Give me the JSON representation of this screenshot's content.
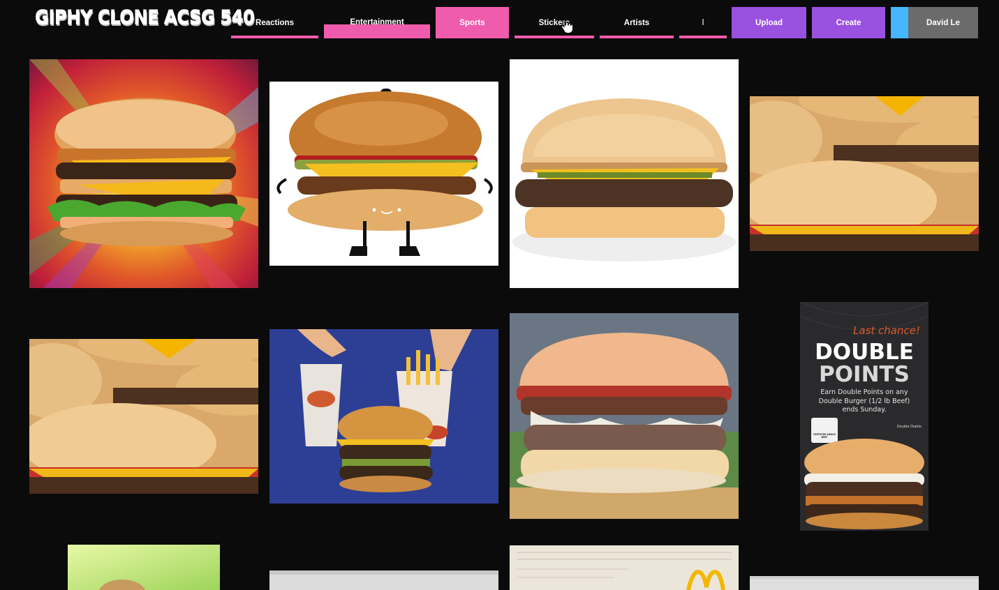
{
  "app": {
    "logo_text": "GIPHY CLONE ACSG 540"
  },
  "nav": {
    "items": [
      {
        "label": "Reactions",
        "accent": "#f05cad"
      },
      {
        "label": "Entertainment",
        "accent": "#f05cad"
      },
      {
        "label": "Sports",
        "accent": "#f05cad"
      },
      {
        "label": "Stickers",
        "accent": "#f05cad"
      },
      {
        "label": "Artists",
        "accent": "#f05cad"
      },
      {
        "label": "⋮",
        "accent": "#f05cad"
      }
    ]
  },
  "actions": {
    "upload_label": "Upload",
    "create_label": "Create",
    "user_name": "David Le",
    "upload_color": "#9b51e0",
    "create_color": "#9b51e0",
    "user_accent": "#46b6ff"
  },
  "gifs": [
    {
      "name": "double-cheeseburger-rainbow-burst-gif"
    },
    {
      "name": "cartoon-burger-with-hat-gif"
    },
    {
      "name": "single-cheeseburger-white-bg-gif"
    },
    {
      "name": "stacked-cheeseburgers-gif"
    },
    {
      "name": "stacked-cheeseburgers-gif-2"
    },
    {
      "name": "burger-king-fries-ad-gif"
    },
    {
      "name": "juicy-burger-close-up-gif"
    },
    {
      "name": "double-points-burger-ad-gif"
    },
    {
      "name": "burger-green-bg-gif"
    },
    {
      "name": "grey-burger-gif"
    },
    {
      "name": "mcdonalds-paper-gif"
    },
    {
      "name": "grey-burger-gif-2"
    }
  ],
  "ad": {
    "headline_small": "Last chance!",
    "headline_1": "DOUBLE",
    "headline_2": "POINTS",
    "body": "Earn Double Points on any Double Burger (1/2 lb Beef) ends Sunday.",
    "product": "Double Diablo",
    "badge": "CERTIFIED ANGUS BEEF"
  }
}
